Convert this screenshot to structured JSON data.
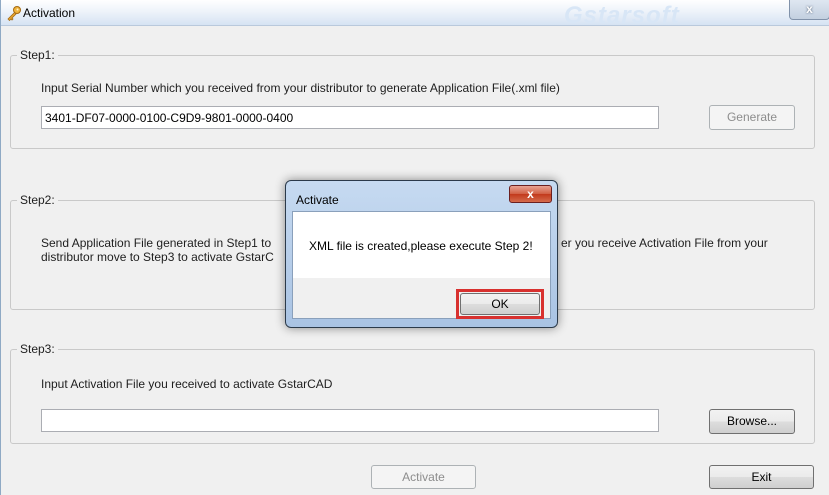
{
  "window": {
    "title": "Activation",
    "brand": "Gstarsoft",
    "close_label": "x"
  },
  "step1": {
    "label": "Step1:",
    "instruction": "Input Serial Number which you received from your distributor to generate Application File(.xml file)",
    "serial_value": "3401-DF07-0000-0100-C9D9-9801-0000-0400",
    "generate_label": "Generate"
  },
  "step2": {
    "label": "Step2:",
    "text_line1_left": "Send Application File generated in Step1 to",
    "text_line1_right": "er you receive Activation File from your",
    "text_line2_left": "distributor move to Step3 to activate GstarC"
  },
  "step3": {
    "label": "Step3:",
    "instruction": "Input Activation File you received to activate GstarCAD",
    "file_value": "",
    "browse_label": "Browse..."
  },
  "footer": {
    "activate_label": "Activate",
    "exit_label": "Exit"
  },
  "dialog": {
    "title": "Activate",
    "close_label": "x",
    "message": "XML file is created,please execute Step 2!",
    "ok_label": "OK"
  },
  "colors": {
    "highlight": "#d8312f",
    "title_gradient_end": "#d6e3f3"
  }
}
